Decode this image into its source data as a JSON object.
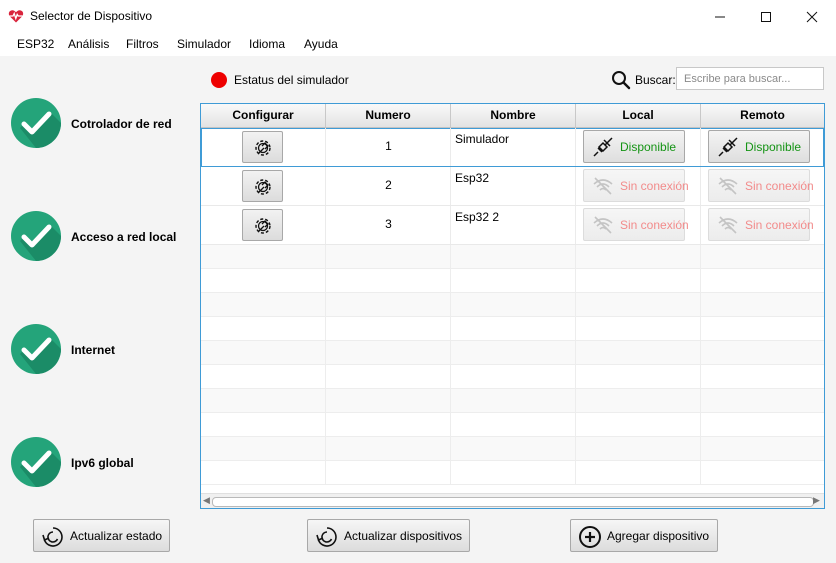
{
  "window": {
    "title": "Selector de Dispositivo",
    "app_icon": "heart-pulse-icon",
    "controls": [
      "minimize-icon",
      "maximize-icon",
      "close-icon"
    ]
  },
  "menu": [
    "ESP32",
    "Análisis",
    "Filtros",
    "Simulador",
    "Idioma",
    "Ayuda"
  ],
  "status_panel": [
    {
      "label": "Cotrolador de red",
      "icon": "check-icon",
      "ok": true
    },
    {
      "label": "Acceso a red local",
      "icon": "check-icon",
      "ok": true
    },
    {
      "label": "Internet",
      "icon": "check-icon",
      "ok": true
    },
    {
      "label": "Ipv6 global",
      "icon": "check-icon",
      "ok": true
    }
  ],
  "simulator": {
    "label": "Estatus del simulador",
    "indicator_color": "#ee0000"
  },
  "search": {
    "label": "Buscar:",
    "placeholder": "Escribe para buscar...",
    "value": "",
    "icon": "search-icon"
  },
  "table": {
    "columns": [
      "Configurar",
      "Numero",
      "Nombre",
      "Local",
      "Remoto"
    ],
    "rows": [
      {
        "numero": "1",
        "nombre": "Simulador",
        "local": "Disponible",
        "remoto": "Disponible",
        "local_available": true,
        "remoto_available": true,
        "selected": true
      },
      {
        "numero": "2",
        "nombre": "Esp32",
        "local": "Sin conexión",
        "remoto": "Sin conexión",
        "local_available": false,
        "remoto_available": false,
        "selected": false
      },
      {
        "numero": "3",
        "nombre": "Esp32 2",
        "local": "Sin conexión",
        "remoto": "Sin conexión",
        "local_available": false,
        "remoto_available": false,
        "selected": false
      }
    ]
  },
  "buttons": {
    "refresh_status": "Actualizar estado",
    "refresh_devices": "Actualizar dispositivos",
    "add_device": "Agregar dispositivo"
  },
  "colors": {
    "accent": "#3f9bd6",
    "ok_green": "#24a47a",
    "available": "#159415",
    "unavailable": "#f28b8b"
  }
}
